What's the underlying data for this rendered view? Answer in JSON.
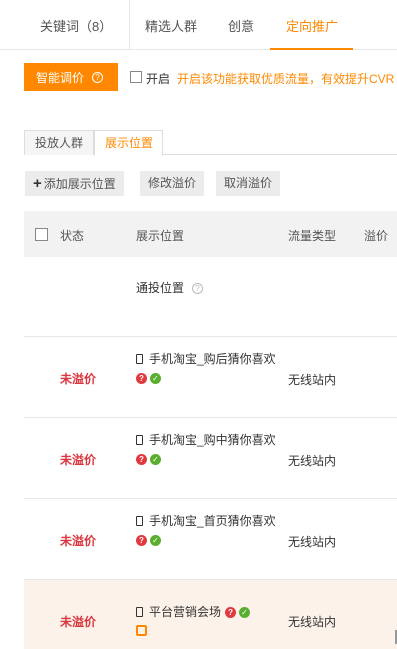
{
  "top_tabs": {
    "keywords": "关键词（8）",
    "crowd": "精选人群",
    "creative": "创意",
    "targeting": "定向推广"
  },
  "smart_bid": {
    "label": "智能调价",
    "help_icon": "question-icon",
    "open_label": "开启",
    "hint": "开启该功能获取优质流量，有效提升CVR"
  },
  "sub_tabs": {
    "crowd": "投放人群",
    "position": "展示位置"
  },
  "actions": {
    "add": "添加展示位置",
    "edit": "修改溢价",
    "cancel": "取消溢价"
  },
  "table": {
    "headers": {
      "status": "状态",
      "position": "展示位置",
      "traffic": "流量类型",
      "premium": "溢价"
    },
    "rows": [
      {
        "status": "",
        "position": "通投位置",
        "traffic": ""
      },
      {
        "status": "未溢价",
        "position": "手机淘宝_购后猜你喜欢",
        "traffic": "无线站内"
      },
      {
        "status": "未溢价",
        "position": "手机淘宝_购中猜你喜欢",
        "traffic": "无线站内"
      },
      {
        "status": "未溢价",
        "position": "手机淘宝_首页猜你喜欢",
        "traffic": "无线站内"
      },
      {
        "status": "未溢价",
        "position": "平台营销会场",
        "traffic": "无线站内"
      }
    ]
  },
  "colors": {
    "accent": "#ff8800",
    "status_red": "#d9363e",
    "ok_green": "#5aae2f",
    "highlight_row": "#fdf2ea"
  }
}
